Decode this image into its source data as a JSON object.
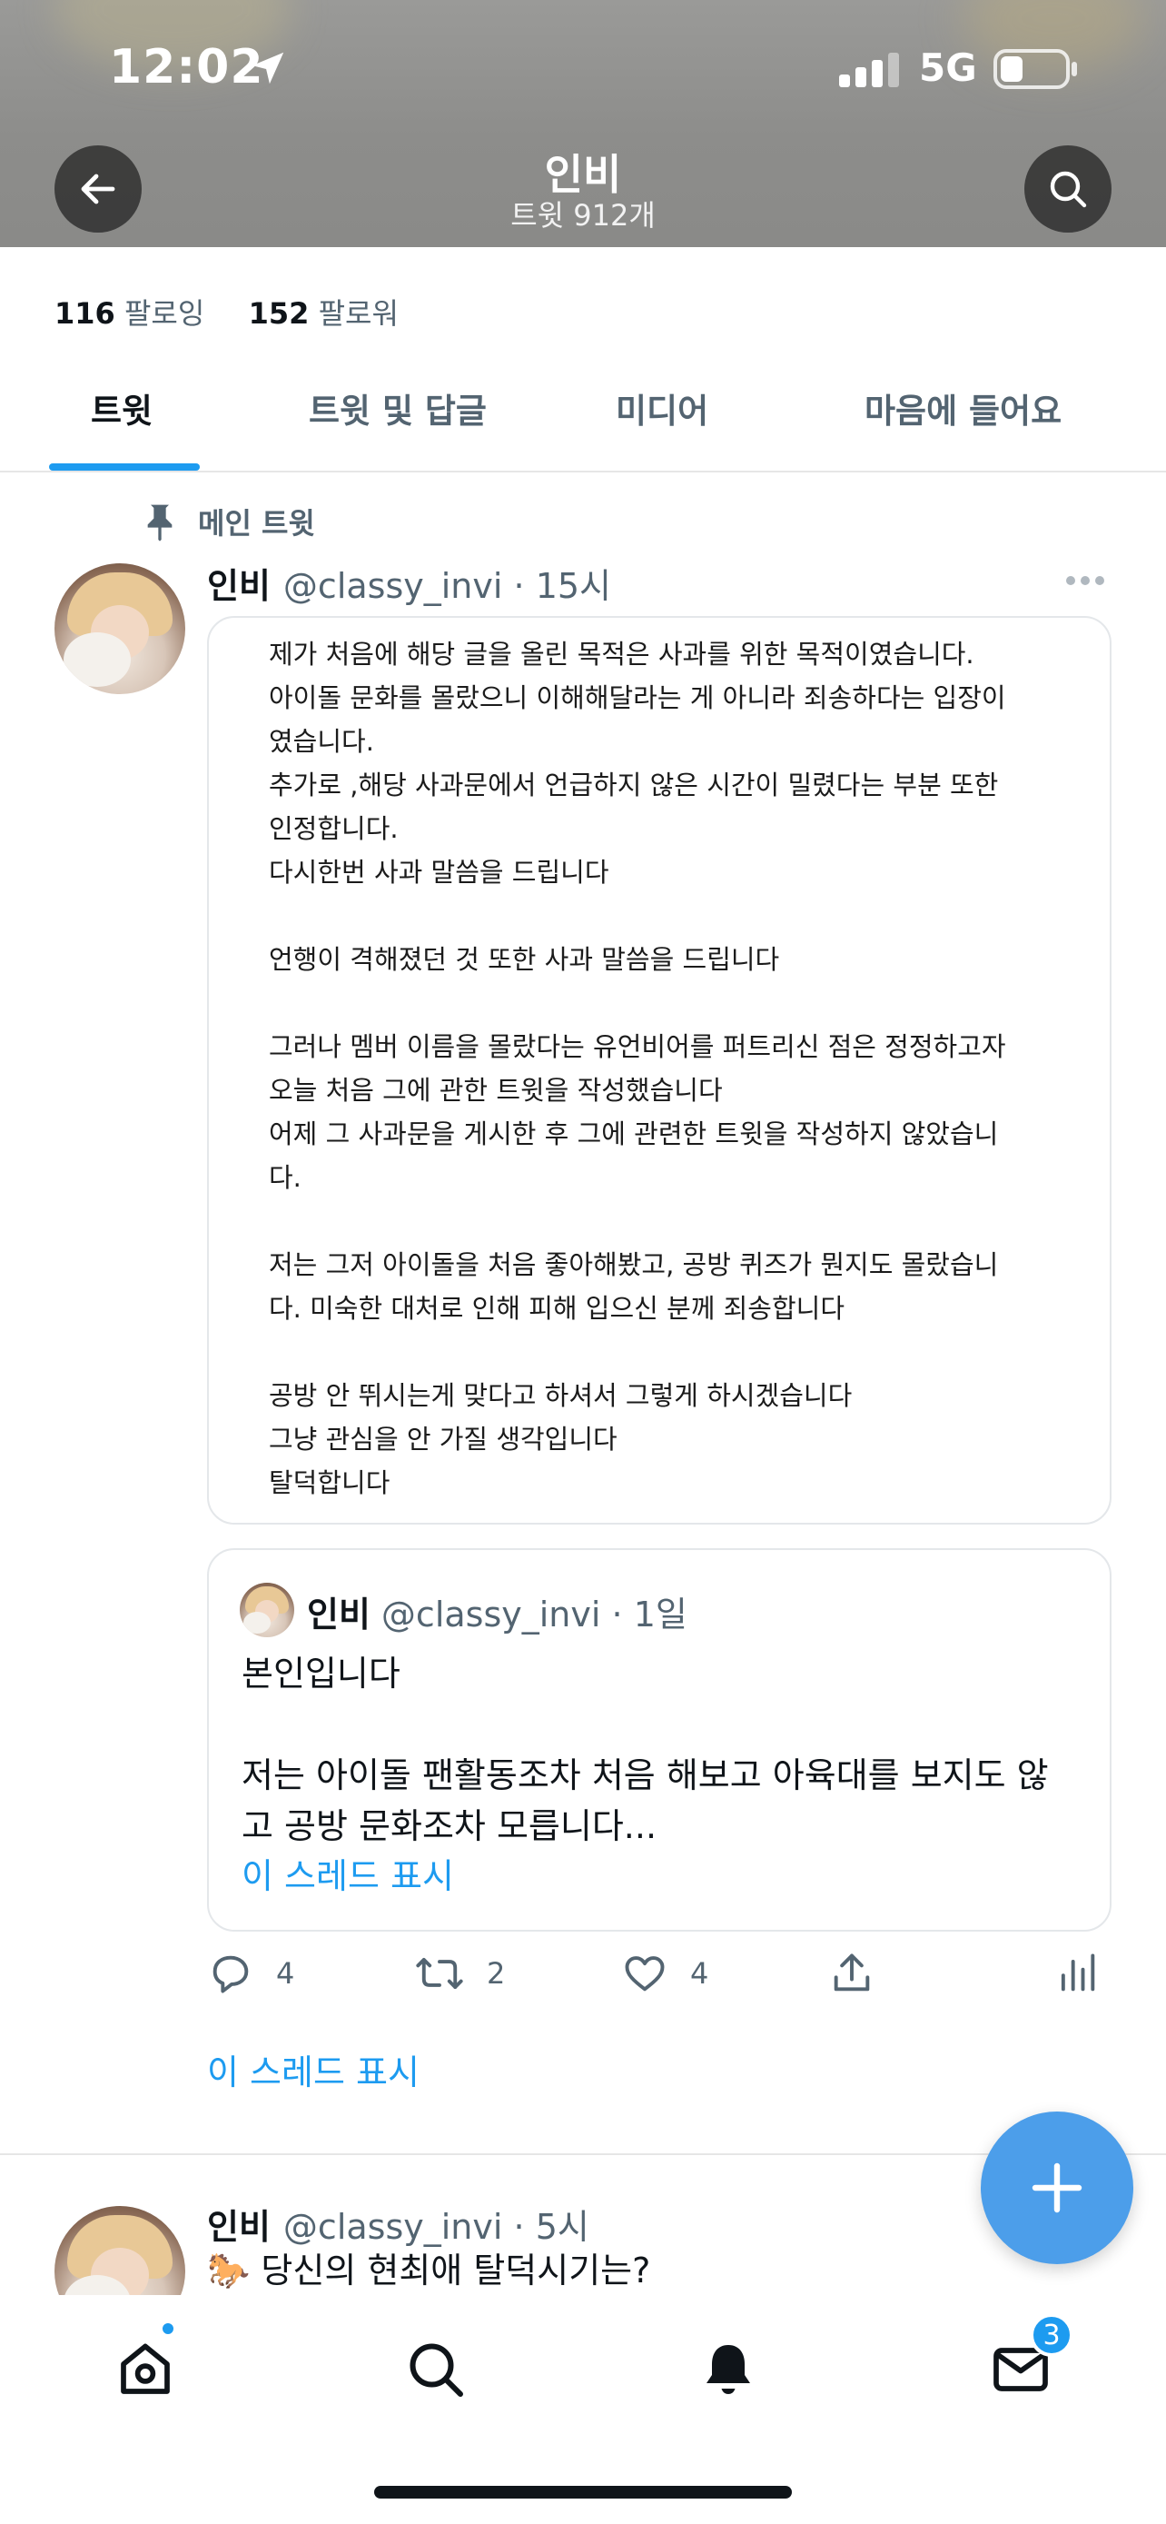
{
  "status_bar": {
    "time": "12:02",
    "network": "5G"
  },
  "header": {
    "title": "인비",
    "subtitle": "트윗 912개"
  },
  "profile": {
    "following_count": "116",
    "following_label": "팔로잉",
    "followers_count": "152",
    "followers_label": "팔로워"
  },
  "tabs": [
    {
      "label": "트윗",
      "active": true
    },
    {
      "label": "트윗 및 답글",
      "active": false
    },
    {
      "label": "미디어",
      "active": false
    },
    {
      "label": "마음에 들어요",
      "active": false
    }
  ],
  "pinned": {
    "label": "메인 트윗",
    "name": "인비",
    "handle": "@classy_invi",
    "time": "· 15시",
    "image_text": [
      "제가 처음에 해당 글을 올린 목적은 사과를 위한 목적이였습니다.",
      "아이돌 문화를 몰랐으니 이해해달라는 게 아니라 죄송하다는 입장이",
      "였습니다.",
      "추가로 ,해당 사과문에서 언급하지 않은 시간이 밀렸다는 부분 또한",
      "인정합니다.",
      "다시한번 사과 말씀을 드립니다",
      "",
      "언행이 격해졌던 것 또한 사과 말씀을 드립니다",
      "",
      "그러나 멤버 이름을 몰랐다는 유언비어를 퍼트리신 점은 정정하고자",
      "오늘 처음 그에 관한 트윗을 작성했습니다",
      "어제 그 사과문을 게시한 후 그에 관련한 트윗을 작성하지 않았습니",
      "다.",
      "",
      "저는 그저 아이돌을 처음 좋아해봤고, 공방 퀴즈가 뭔지도 몰랐습니",
      "다. 미숙한 대처로 인해 피해 입으신 분께 죄송합니다",
      "",
      "공방 안 뛰시는게 맞다고 하셔서 그렇게 하시겠습니다",
      "그냥 관심을 안 가질 생각입니다",
      "탈덕합니다"
    ],
    "quote": {
      "name": "인비",
      "handle": "@classy_invi",
      "time": "· 1일",
      "lines": [
        "본인입니다",
        "",
        "저는 아이돌 팬활동조차 처음 해보고 아육대를 보지도 않",
        "고 공방 문화조차 모릅니다..."
      ],
      "thread_link": "이 스레드 표시"
    },
    "replies": "4",
    "retweets": "2",
    "likes": "4",
    "thread_link": "이 스레드 표시"
  },
  "second_tweet": {
    "name": "인비",
    "handle": "@classy_invi",
    "time": "· 5시",
    "emoji": "🐎",
    "text": "당신의 현최애 탈덕시기는?"
  },
  "bottom_nav": {
    "messages_badge": "3"
  },
  "colors": {
    "accent": "#1d9bf0",
    "text_secondary": "#536471",
    "fab": "#4c9eea"
  }
}
